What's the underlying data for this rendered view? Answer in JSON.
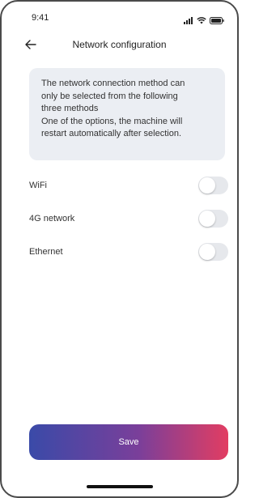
{
  "status_bar": {
    "time": "9:41",
    "icons": [
      "signal-icon",
      "wifi-icon",
      "battery-icon"
    ]
  },
  "header": {
    "title": "Network configuration",
    "back_icon": "arrow-left-icon"
  },
  "info": {
    "lines": [
      "The network connection method can",
      "only be selected from the following",
      "three methods",
      "One of the options, the machine will",
      "restart automatically after selection."
    ]
  },
  "options": [
    {
      "label": "WiFi",
      "enabled": false
    },
    {
      "label": "4G network",
      "enabled": false
    },
    {
      "label": "Ethernet",
      "enabled": false
    }
  ],
  "actions": {
    "save_label": "Save"
  },
  "colors": {
    "info_background": "#ebeef3",
    "toggle_off": "#e6e8ec",
    "save_gradient_start": "#3a4aa8",
    "save_gradient_end": "#e23d62"
  }
}
